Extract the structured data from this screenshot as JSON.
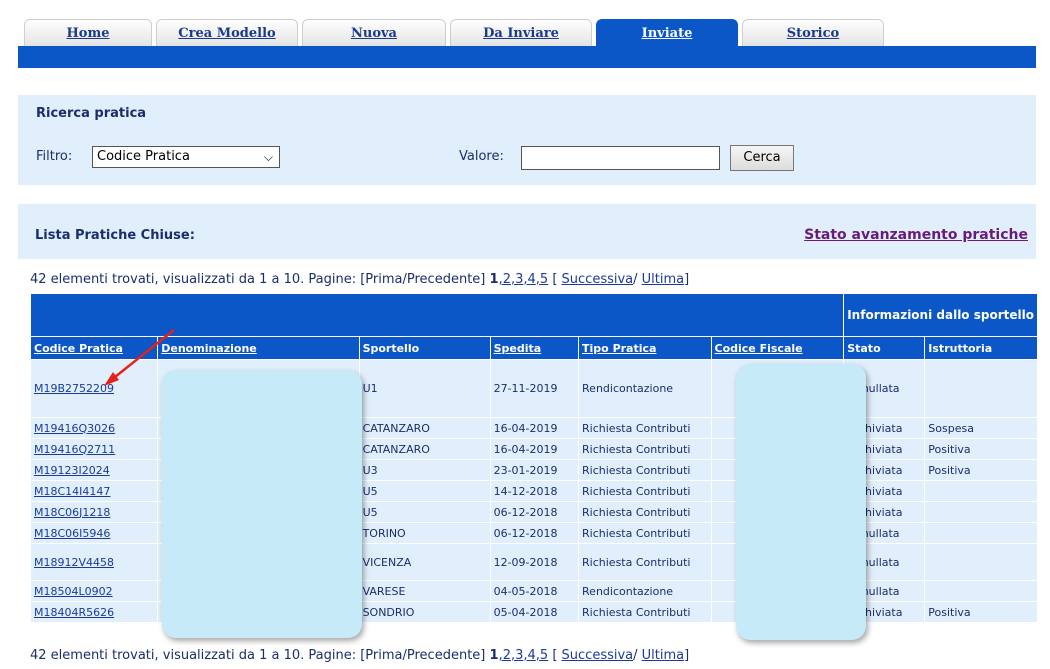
{
  "tabs": [
    {
      "label": "Home",
      "active": false
    },
    {
      "label": "Crea Modello",
      "active": false
    },
    {
      "label": "Nuova",
      "active": false
    },
    {
      "label": "Da Inviare",
      "active": false
    },
    {
      "label": "Inviate",
      "active": true
    },
    {
      "label": "Storico",
      "active": false
    }
  ],
  "search": {
    "title": "Ricerca pratica",
    "filter_label": "Filtro:",
    "filter_selected": "Codice Pratica",
    "value_label": "Valore:",
    "value_text": "",
    "button": "Cerca"
  },
  "list": {
    "title": "Lista Pratiche Chiuse:",
    "status_link": "Stato avanzamento pratiche"
  },
  "pager": {
    "summary": "42 elementi trovati, visualizzati da 1 a 10. Pagine: [",
    "first": "Prima",
    "sep1": "/",
    "prev": "Precedente",
    "close": "] ",
    "current": "1",
    "pages": [
      ",2",
      ",3",
      ",4",
      ",5"
    ],
    "open2": " [ ",
    "next": "Successiva",
    "sep2": "/ ",
    "last": "Ultima",
    "end": "]"
  },
  "table": {
    "info_header": "Informazioni dallo sportello",
    "columns": [
      "Codice Pratica",
      "Denominazione",
      "Sportello",
      "Spedita",
      "Tipo Pratica",
      "Codice Fiscale",
      "Stato",
      "Istruttoria"
    ],
    "rows": [
      {
        "codice": "M19B2752209",
        "denominazione": "",
        "sportello": "U1",
        "spedita": "27-11-2019",
        "tipo": "Rendicontazione",
        "cf": "",
        "stato": "Annullata",
        "istruttoria": ""
      },
      {
        "codice": "M19416Q3026",
        "denominazione": "",
        "sportello": "CATANZARO",
        "spedita": "16-04-2019",
        "tipo": "Richiesta Contributi",
        "cf": "",
        "stato": "Archiviata",
        "istruttoria": "Sospesa"
      },
      {
        "codice": "M19416Q2711",
        "denominazione": "",
        "sportello": "CATANZARO",
        "spedita": "16-04-2019",
        "tipo": "Richiesta Contributi",
        "cf": "",
        "stato": "Archiviata",
        "istruttoria": "Positiva"
      },
      {
        "codice": "M19123I2024",
        "denominazione": "",
        "sportello": "U3",
        "spedita": "23-01-2019",
        "tipo": "Richiesta Contributi",
        "cf": "",
        "stato": "Archiviata",
        "istruttoria": "Positiva"
      },
      {
        "codice": "M18C14I4147",
        "denominazione": "",
        "sportello": "U5",
        "spedita": "14-12-2018",
        "tipo": "Richiesta Contributi",
        "cf": "",
        "stato": "Archiviata",
        "istruttoria": ""
      },
      {
        "codice": "M18C06J1218",
        "denominazione": "",
        "sportello": "U5",
        "spedita": "06-12-2018",
        "tipo": "Richiesta Contributi",
        "cf": "",
        "stato": "Archiviata",
        "istruttoria": ""
      },
      {
        "codice": "M18C06I5946",
        "denominazione": "",
        "sportello": "TORINO",
        "spedita": "06-12-2018",
        "tipo": "Richiesta Contributi",
        "cf": "",
        "stato": "Annullata",
        "istruttoria": ""
      },
      {
        "codice": "M18912V4458",
        "denominazione": "",
        "sportello": "VICENZA",
        "spedita": "12-09-2018",
        "tipo": "Richiesta Contributi",
        "cf": "",
        "stato": "Annullata",
        "istruttoria": ""
      },
      {
        "codice": "M18504L0902",
        "denominazione": "",
        "sportello": "VARESE",
        "spedita": "04-05-2018",
        "tipo": "Rendicontazione",
        "cf": "",
        "stato": "Annullata",
        "istruttoria": ""
      },
      {
        "codice": "M18404R5626",
        "denominazione": "",
        "sportello": "SONDRIO",
        "spedita": "05-04-2018",
        "tipo": "Richiesta Contributi",
        "cf": "",
        "stato": "Archiviata",
        "istruttoria": "Positiva"
      }
    ]
  },
  "colors": {
    "accent": "#0b57c8",
    "panel": "#e1effc",
    "link": "#1a3aa0",
    "annotation_arrow": "#e8201a",
    "redaction": "#c6eaf8"
  }
}
